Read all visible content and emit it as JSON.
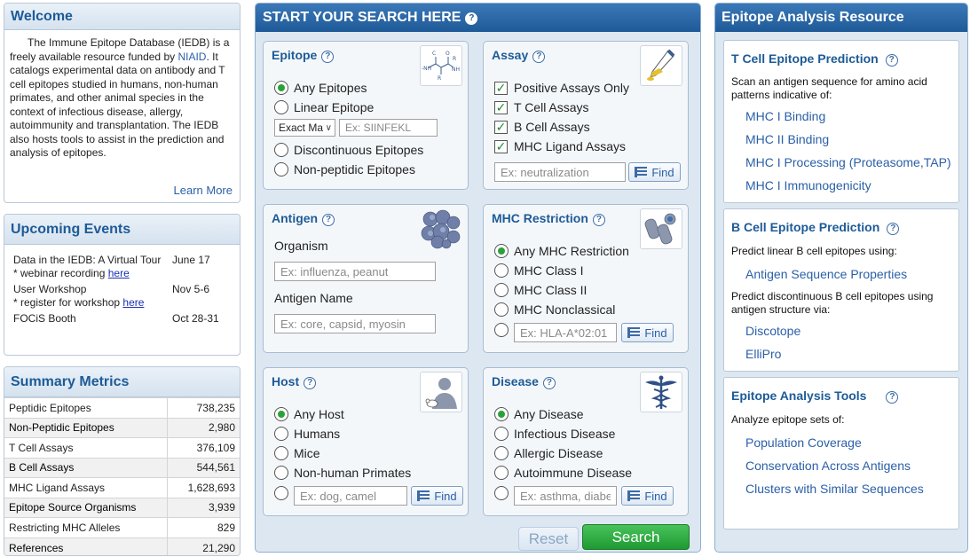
{
  "welcome": {
    "title": "Welcome",
    "text_before_link": "The Immune Epitope Database (IEDB) is a freely available resource funded by ",
    "link": "NIAID",
    "text_after_link": ". It catalogs experimental data on antibody and T cell epitopes studied in humans, non-human primates, and other animal species in the context of infectious disease, allergy, autoimmunity and transplantation. The IEDB also hosts tools to assist in the prediction and analysis of epitopes.",
    "learn_more": "Learn More"
  },
  "events": {
    "title": "Upcoming Events",
    "items": [
      {
        "title": "Data in the IEDB: A Virtual Tour",
        "date": "June 17",
        "note": "* webinar recording ",
        "note_link": "here"
      },
      {
        "title": "User Workshop",
        "date": "Nov 5-6",
        "note": "* register for workshop ",
        "note_link": "here"
      },
      {
        "title": "FOCiS Booth",
        "date": "Oct 28-31"
      }
    ]
  },
  "metrics": {
    "title": "Summary Metrics",
    "rows": [
      {
        "label": "Peptidic Epitopes",
        "value": "738,235"
      },
      {
        "label": "Non-Peptidic Epitopes",
        "value": "2,980"
      },
      {
        "label": "T Cell Assays",
        "value": "376,109"
      },
      {
        "label": "B Cell Assays",
        "value": "544,561"
      },
      {
        "label": "MHC Ligand Assays",
        "value": "1,628,693"
      },
      {
        "label": "Epitope Source Organisms",
        "value": "3,939"
      },
      {
        "label": "Restricting MHC Alleles",
        "value": "829"
      },
      {
        "label": "References",
        "value": "21,290"
      }
    ]
  },
  "search": {
    "title": "START YOUR SEARCH HERE",
    "help": "?",
    "epitope": {
      "title": "Epitope",
      "options": [
        "Any Epitopes",
        "Linear Epitope",
        "Discontinuous Epitopes",
        "Non-peptidic Epitopes"
      ],
      "match_select": "Exact Ma",
      "seq_placeholder": "Ex: SIINFEKL"
    },
    "assay": {
      "title": "Assay",
      "checks": [
        "Positive Assays Only",
        "T Cell Assays",
        "B Cell Assays",
        "MHC Ligand Assays"
      ],
      "placeholder": "Ex: neutralization",
      "find": "Find"
    },
    "antigen": {
      "title": "Antigen",
      "organism_label": "Organism",
      "organism_placeholder": "Ex: influenza, peanut",
      "name_label": "Antigen Name",
      "name_placeholder": "Ex: core, capsid, myosin"
    },
    "mhc": {
      "title": "MHC Restriction",
      "options": [
        "Any MHC Restriction",
        "MHC Class I",
        "MHC Class II",
        "MHC Nonclassical"
      ],
      "placeholder": "Ex: HLA-A*02:01",
      "find": "Find"
    },
    "host": {
      "title": "Host",
      "options": [
        "Any Host",
        "Humans",
        "Mice",
        "Non-human Primates"
      ],
      "placeholder": "Ex: dog, camel",
      "find": "Find"
    },
    "disease": {
      "title": "Disease",
      "options": [
        "Any Disease",
        "Infectious Disease",
        "Allergic Disease",
        "Autoimmune Disease"
      ],
      "placeholder": "Ex: asthma, diabetes",
      "find": "Find"
    },
    "reset": "Reset",
    "submit": "Search"
  },
  "analysis": {
    "title": "Epitope Analysis Resource",
    "tcell": {
      "title": "T Cell Epitope Prediction",
      "desc": "Scan an antigen sequence for amino acid patterns indicative of:",
      "links": [
        "MHC I Binding",
        "MHC II Binding",
        "MHC I Processing (Proteasome,TAP)",
        "MHC I Immunogenicity"
      ]
    },
    "bcell": {
      "title": "B Cell Epitope Prediction",
      "desc1": "Predict linear B cell epitopes using:",
      "link1": "Antigen Sequence Properties",
      "desc2": "Predict discontinuous B cell epitopes using antigen structure via:",
      "links2": [
        "Discotope",
        "ElliPro"
      ]
    },
    "tools": {
      "title": "Epitope Analysis Tools",
      "desc": "Analyze epitope sets of:",
      "links": [
        "Population Coverage",
        "Conservation Across Antigens",
        "Clusters with Similar Sequences"
      ]
    }
  }
}
